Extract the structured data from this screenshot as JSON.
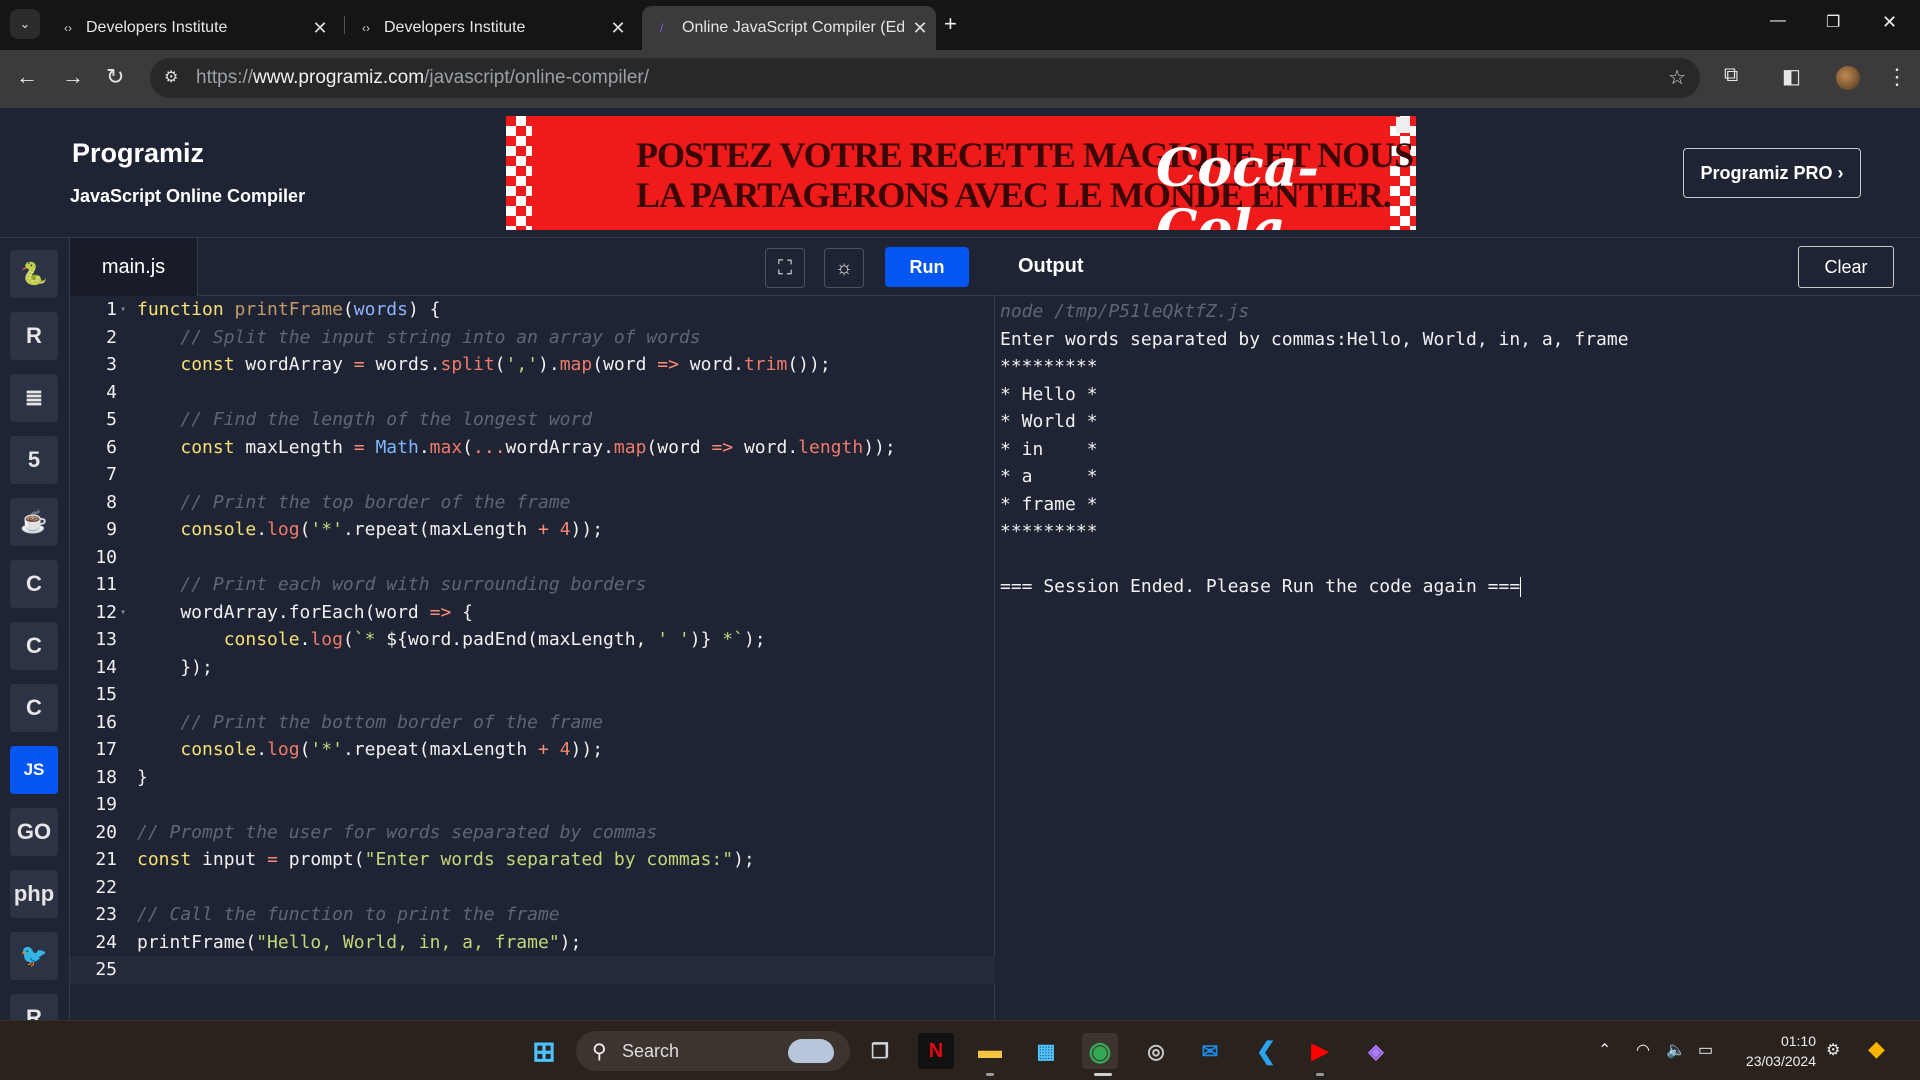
{
  "browser": {
    "tabs": [
      {
        "title": "Developers Institute",
        "active": false
      },
      {
        "title": "Developers Institute",
        "active": false
      },
      {
        "title": "Online JavaScript Compiler (Edi",
        "active": true
      }
    ],
    "url_prefix": "https://",
    "url_host": "www.programiz.com",
    "url_path": "/javascript/online-compiler/"
  },
  "site": {
    "logo": "Programiz",
    "subtitle": "JavaScript Online Compiler",
    "pro_button": "Programiz PRO ›",
    "ad": {
      "line1": "POSTEZ VOTRE RECETTE MAGIQUE ET NOUS",
      "line2": "LA PARTAGERONS AVEC LE MONDE ENTIER.",
      "brand": "Coca-Cola"
    }
  },
  "languages": [
    {
      "name": "python-icon",
      "glyph": "🐍"
    },
    {
      "name": "r-icon",
      "glyph": "R"
    },
    {
      "name": "sql-icon",
      "glyph": "≣"
    },
    {
      "name": "html-icon",
      "glyph": "5"
    },
    {
      "name": "java-icon",
      "glyph": "☕"
    },
    {
      "name": "c-icon",
      "glyph": "C"
    },
    {
      "name": "cpp-icon",
      "glyph": "C"
    },
    {
      "name": "csharp-icon",
      "glyph": "C"
    },
    {
      "name": "javascript-icon",
      "glyph": "JS",
      "active": true
    },
    {
      "name": "go-icon",
      "glyph": "GO"
    },
    {
      "name": "php-icon",
      "glyph": "php"
    },
    {
      "name": "swift-icon",
      "glyph": "🐦"
    },
    {
      "name": "rust-icon",
      "glyph": "R"
    }
  ],
  "editor": {
    "filename": "main.js",
    "run_label": "Run",
    "lines": [
      [
        [
          "c-kw",
          "function "
        ],
        [
          "c-def",
          "printFrame"
        ],
        [
          "",
          "("
        ],
        [
          "c-par",
          "words"
        ],
        [
          "",
          ") {"
        ]
      ],
      [
        [
          "",
          "    "
        ],
        [
          "c-com",
          "// Split the input string into an array of words"
        ]
      ],
      [
        [
          "",
          "    "
        ],
        [
          "c-kw",
          "const "
        ],
        [
          "",
          "wordArray "
        ],
        [
          "c-op",
          "= "
        ],
        [
          "",
          "words."
        ],
        [
          "c-prop",
          "split"
        ],
        [
          "",
          "("
        ],
        [
          "c-str",
          "','"
        ],
        [
          "",
          ")."
        ],
        [
          "c-prop",
          "map"
        ],
        [
          "",
          "(word "
        ],
        [
          "c-op",
          "=> "
        ],
        [
          "",
          "word."
        ],
        [
          "c-prop",
          "trim"
        ],
        [
          "",
          "());"
        ]
      ],
      [],
      [
        [
          "",
          "    "
        ],
        [
          "c-com",
          "// Find the length of the longest word"
        ]
      ],
      [
        [
          "",
          "    "
        ],
        [
          "c-kw",
          "const "
        ],
        [
          "",
          "maxLength "
        ],
        [
          "c-op",
          "= "
        ],
        [
          "c-math",
          "Math"
        ],
        [
          "",
          "."
        ],
        [
          "c-prop",
          "max"
        ],
        [
          "",
          "("
        ],
        [
          "c-op",
          "..."
        ],
        [
          "",
          "wordArray."
        ],
        [
          "c-prop",
          "map"
        ],
        [
          "",
          "(word "
        ],
        [
          "c-op",
          "=> "
        ],
        [
          "",
          "word."
        ],
        [
          "c-prop",
          "length"
        ],
        [
          "",
          "));"
        ]
      ],
      [],
      [
        [
          "",
          "    "
        ],
        [
          "c-com",
          "// Print the top border of the frame"
        ]
      ],
      [
        [
          "",
          "    "
        ],
        [
          "c-kw",
          "console"
        ],
        [
          "",
          "."
        ],
        [
          "c-prop",
          "log"
        ],
        [
          "",
          "("
        ],
        [
          "c-str",
          "'*'"
        ],
        [
          "",
          ".repeat(maxLength "
        ],
        [
          "c-op",
          "+ "
        ],
        [
          "c-num",
          "4"
        ],
        [
          "",
          "));"
        ]
      ],
      [],
      [
        [
          "",
          "    "
        ],
        [
          "c-com",
          "// Print each word with surrounding borders"
        ]
      ],
      [
        [
          "",
          "    wordArray.forEach(word "
        ],
        [
          "c-op",
          "=> "
        ],
        [
          "",
          "{"
        ]
      ],
      [
        [
          "",
          "        "
        ],
        [
          "c-kw",
          "console"
        ],
        [
          "",
          "."
        ],
        [
          "c-prop",
          "log"
        ],
        [
          "",
          "("
        ],
        [
          "c-str",
          "`* "
        ],
        [
          "",
          "${word.padEnd(maxLength, "
        ],
        [
          "c-str",
          "' '"
        ],
        [
          "",
          ")}"
        ],
        [
          "c-str",
          " *`"
        ],
        [
          "",
          ");"
        ]
      ],
      [
        [
          "",
          "    });"
        ]
      ],
      [],
      [
        [
          "",
          "    "
        ],
        [
          "c-com",
          "// Print the bottom border of the frame"
        ]
      ],
      [
        [
          "",
          "    "
        ],
        [
          "c-kw",
          "console"
        ],
        [
          "",
          "."
        ],
        [
          "c-prop",
          "log"
        ],
        [
          "",
          "("
        ],
        [
          "c-str",
          "'*'"
        ],
        [
          "",
          ".repeat(maxLength "
        ],
        [
          "c-op",
          "+ "
        ],
        [
          "c-num",
          "4"
        ],
        [
          "",
          "));"
        ]
      ],
      [
        [
          "",
          "}"
        ]
      ],
      [],
      [
        [
          "c-com",
          "// Prompt the user for words separated by commas"
        ]
      ],
      [
        [
          "c-kw",
          "const "
        ],
        [
          "",
          "input "
        ],
        [
          "c-op",
          "= "
        ],
        [
          "",
          "prompt("
        ],
        [
          "c-str",
          "\"Enter words separated by commas:\""
        ],
        [
          "",
          ");"
        ]
      ],
      [],
      [
        [
          "c-com",
          "// Call the function to print the frame"
        ]
      ],
      [
        [
          "",
          "printFrame("
        ],
        [
          "c-str",
          "\"Hello, World, in, a, frame\""
        ],
        [
          "",
          ");"
        ]
      ],
      []
    ]
  },
  "output": {
    "title": "Output",
    "clear_label": "Clear",
    "lines": [
      {
        "text": "node /tmp/P51leQktfZ.js",
        "cmd": true
      },
      {
        "text": "Enter words separated by commas:Hello, World, in, a, frame"
      },
      {
        "text": "*********"
      },
      {
        "text": "* Hello *"
      },
      {
        "text": "* World *"
      },
      {
        "text": "* in    *"
      },
      {
        "text": "* a     *"
      },
      {
        "text": "* frame *"
      },
      {
        "text": "*********"
      },
      {
        "text": ""
      },
      {
        "text": "=== Session Ended. Please Run the code again ==="
      }
    ]
  },
  "taskbar": {
    "search_label": "Search",
    "time": "01:10",
    "date": "23/03/2024"
  }
}
